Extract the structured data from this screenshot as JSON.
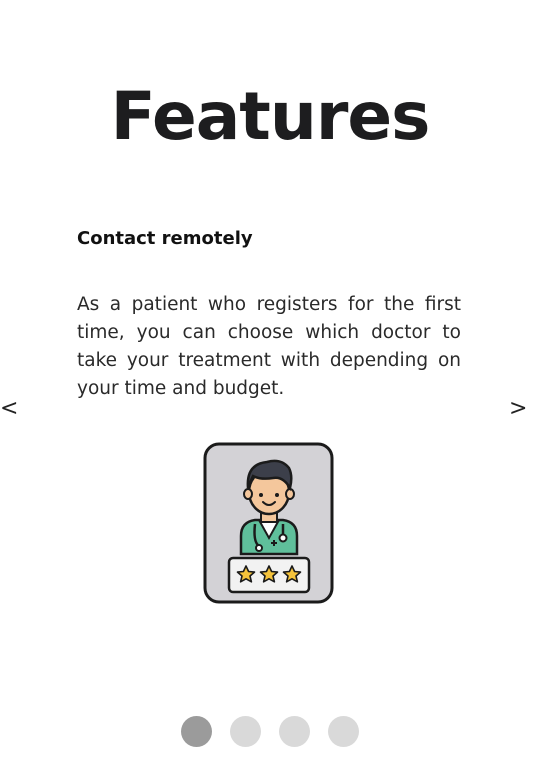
{
  "page": {
    "title": "Features"
  },
  "slide": {
    "heading": "Contact remotely",
    "text": "As a patient who registers for the first time, you can choose which doctor to take your treatment with depending on your time and budget.",
    "illustration_icon": "doctor-rating-card-icon",
    "rating_stars": 3
  },
  "navigation": {
    "prev_label": "<",
    "next_label": ">"
  },
  "pagination": {
    "total": 4,
    "active_index": 0
  },
  "colors": {
    "dot_active": "#9b9b9b",
    "dot_inactive": "#d9d9d9",
    "card_bg": "#d3d2d6",
    "scrubs": "#5fbf9b",
    "star": "#f5c33b"
  }
}
